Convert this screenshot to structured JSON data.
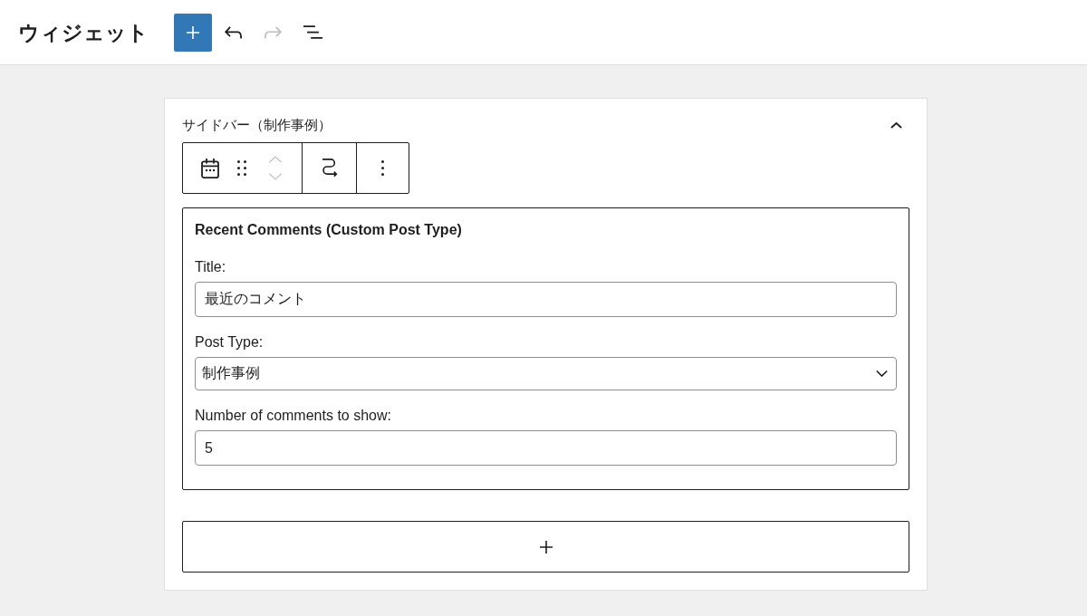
{
  "header": {
    "title": "ウィジェット",
    "toolbar": [
      {
        "kind": "inserter",
        "disabled": false
      },
      {
        "kind": "undo",
        "disabled": false
      },
      {
        "kind": "redo",
        "disabled": true
      },
      {
        "kind": "list-view",
        "disabled": false
      }
    ]
  },
  "panel": {
    "title": "サイドバー（制作事例）",
    "expanded": true,
    "block_toolbar": {
      "groups": [
        {
          "items": [
            {
              "kind": "block-type",
              "disabled": false
            },
            {
              "kind": "drag",
              "disabled": false
            },
            {
              "kind": "mover",
              "buttons": [
                {
                  "kind": "up",
                  "disabled": true
                },
                {
                  "kind": "down",
                  "disabled": true
                }
              ]
            }
          ]
        },
        {
          "items": [
            {
              "kind": "transform",
              "disabled": false
            }
          ]
        },
        {
          "items": [
            {
              "kind": "more",
              "disabled": false
            }
          ]
        }
      ]
    },
    "widget": {
      "title": "Recent Comments (Custom Post Type)",
      "fields": [
        {
          "kind": "text",
          "label": "Title:",
          "value": "最近のコメント"
        },
        {
          "kind": "select",
          "label": "Post Type:",
          "value": "制作事例"
        },
        {
          "kind": "number",
          "label": "Number of comments to show:",
          "value": "5"
        }
      ]
    }
  }
}
